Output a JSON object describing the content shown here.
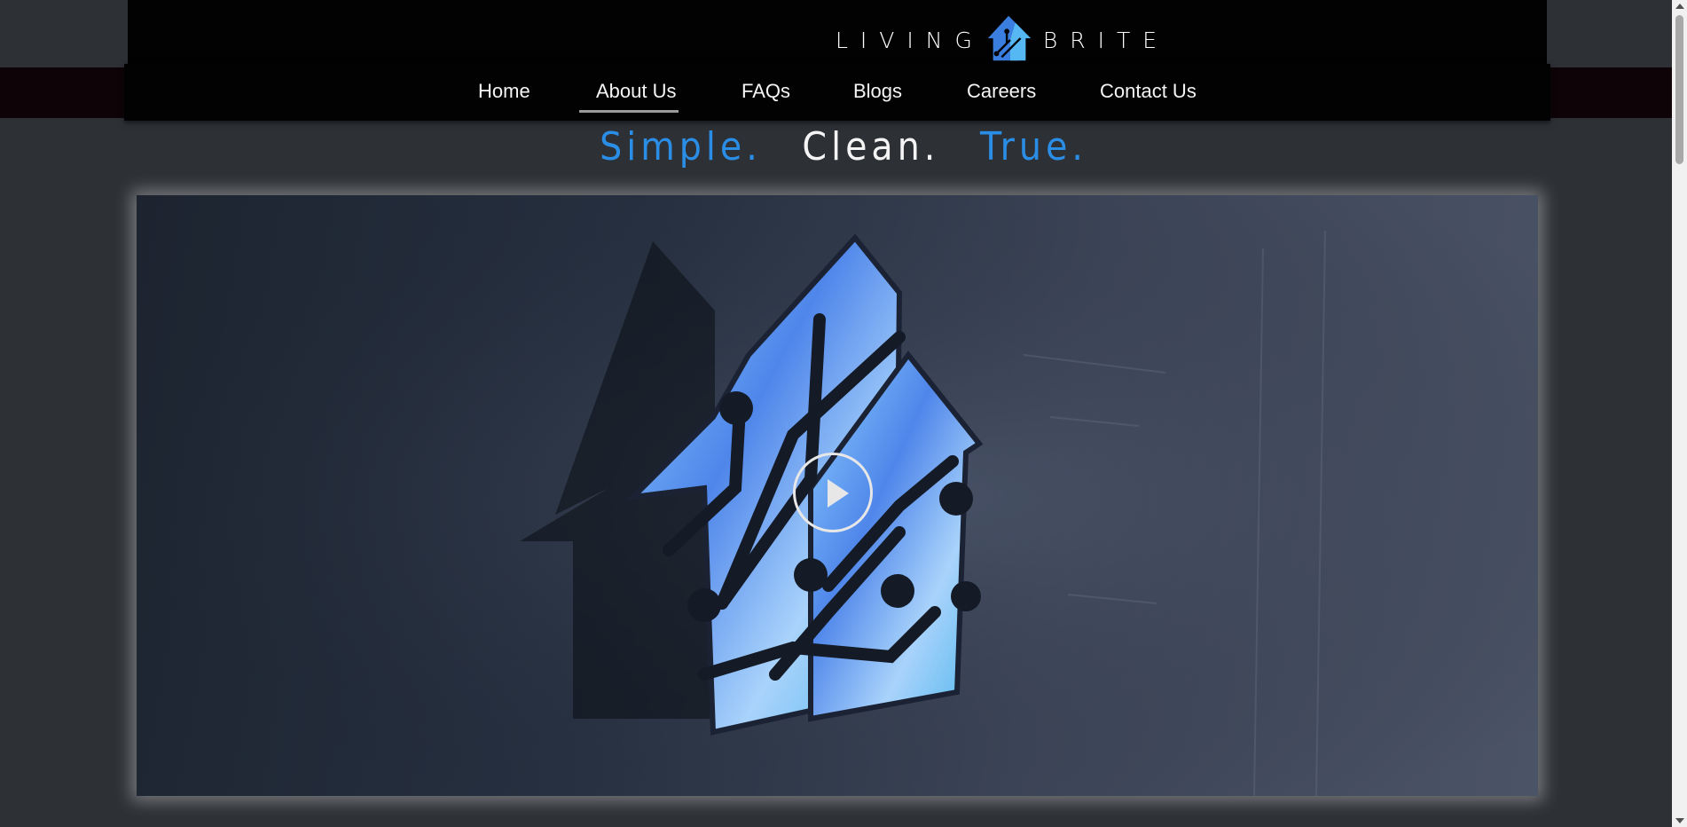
{
  "header": {
    "logo_left": "LIVING",
    "logo_right": "BRITE"
  },
  "nav": {
    "items": [
      {
        "label": "Home",
        "active": true
      },
      {
        "label": "About Us"
      },
      {
        "label": "FAQs"
      },
      {
        "label": "Blogs"
      },
      {
        "label": "Careers"
      },
      {
        "label": "Contact Us"
      }
    ]
  },
  "tagline": {
    "part1": "Simple.",
    "part2": "Clean.",
    "part3": "True."
  },
  "colors": {
    "accent_blue": "#2b8ee6",
    "nav_bg": "#020202",
    "page_bg": "#2d3035"
  },
  "icons": {
    "logo": "house-circuit-icon",
    "play": "play-icon"
  }
}
